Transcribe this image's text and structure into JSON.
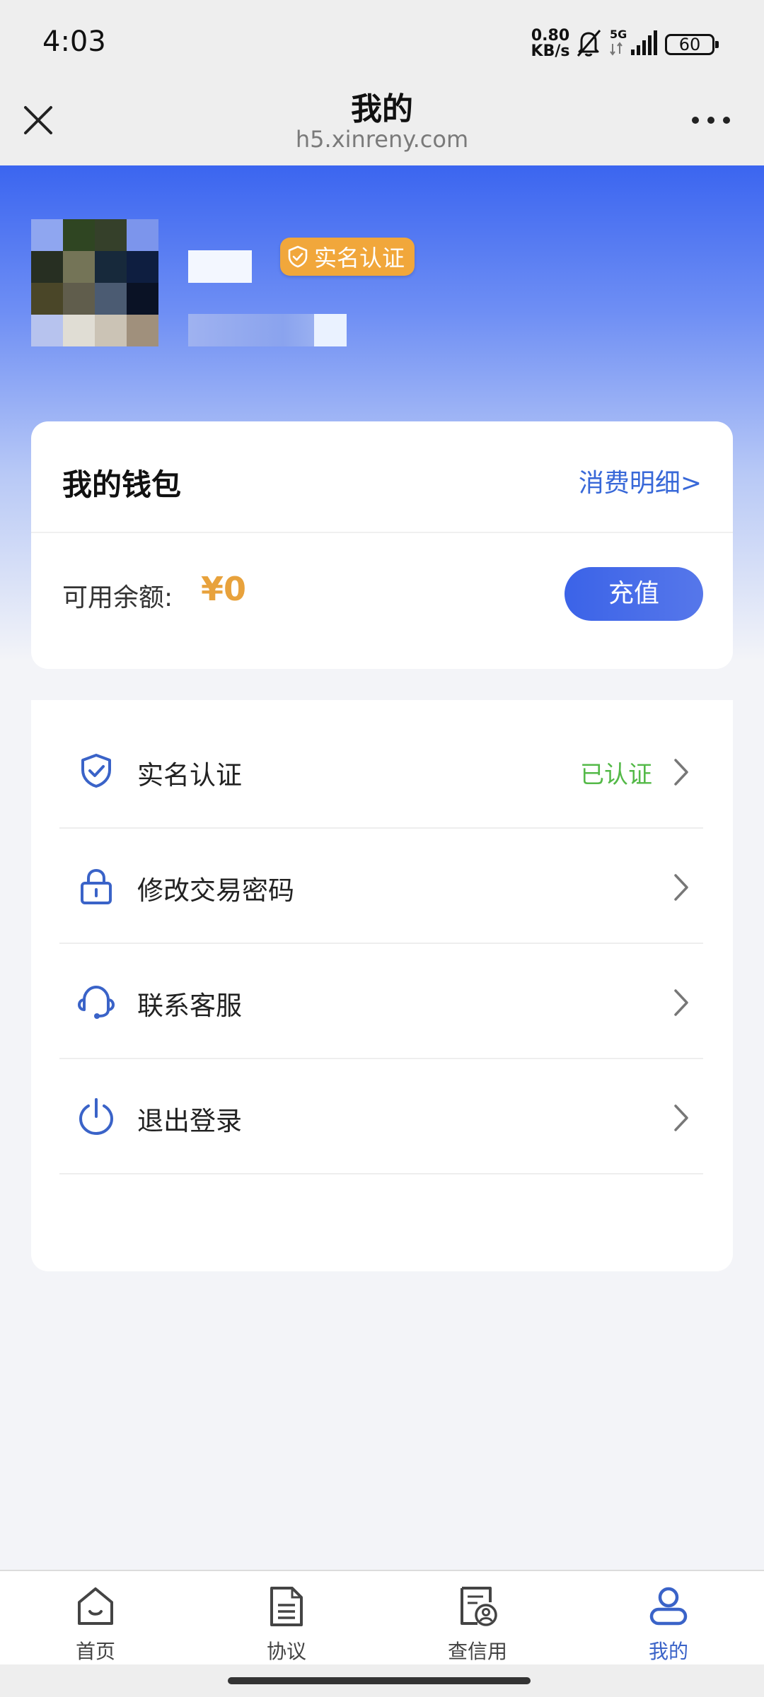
{
  "status_bar": {
    "time": "4:03",
    "net_speed_value": "0.80",
    "net_speed_unit": "KB/s",
    "network": "5G",
    "battery": "60",
    "icons": [
      "bell-off-icon",
      "signal-icon",
      "battery-icon"
    ]
  },
  "header": {
    "title": "我的",
    "url": "h5.xinreny.com",
    "close_icon": "close-icon",
    "more_icon": "more-icon"
  },
  "profile": {
    "badge_label": "实名认证",
    "badge_color": "#f1a73b"
  },
  "wallet": {
    "title": "我的钱包",
    "detail_link": "消费明细>",
    "balance_label": "可用余额:",
    "balance_value": "¥0",
    "recharge_button": "充值"
  },
  "menu": {
    "items": [
      {
        "label": "实名认证",
        "status": "已认证",
        "icon": "shield-check-icon"
      },
      {
        "label": "修改交易密码",
        "status": "",
        "icon": "lock-icon"
      },
      {
        "label": "联系客服",
        "status": "",
        "icon": "headset-icon"
      },
      {
        "label": "退出登录",
        "status": "",
        "icon": "power-icon"
      }
    ]
  },
  "tabbar": {
    "tabs": [
      {
        "label": "首页",
        "icon": "home-icon",
        "active": false
      },
      {
        "label": "协议",
        "icon": "document-icon",
        "active": false
      },
      {
        "label": "查信用",
        "icon": "credit-report-icon",
        "active": false
      },
      {
        "label": "我的",
        "icon": "user-icon",
        "active": true
      }
    ]
  },
  "colors": {
    "primary": "#3b63e8",
    "accent_orange": "#e8a23c",
    "success_green": "#54b948",
    "link_blue": "#3868d8"
  }
}
